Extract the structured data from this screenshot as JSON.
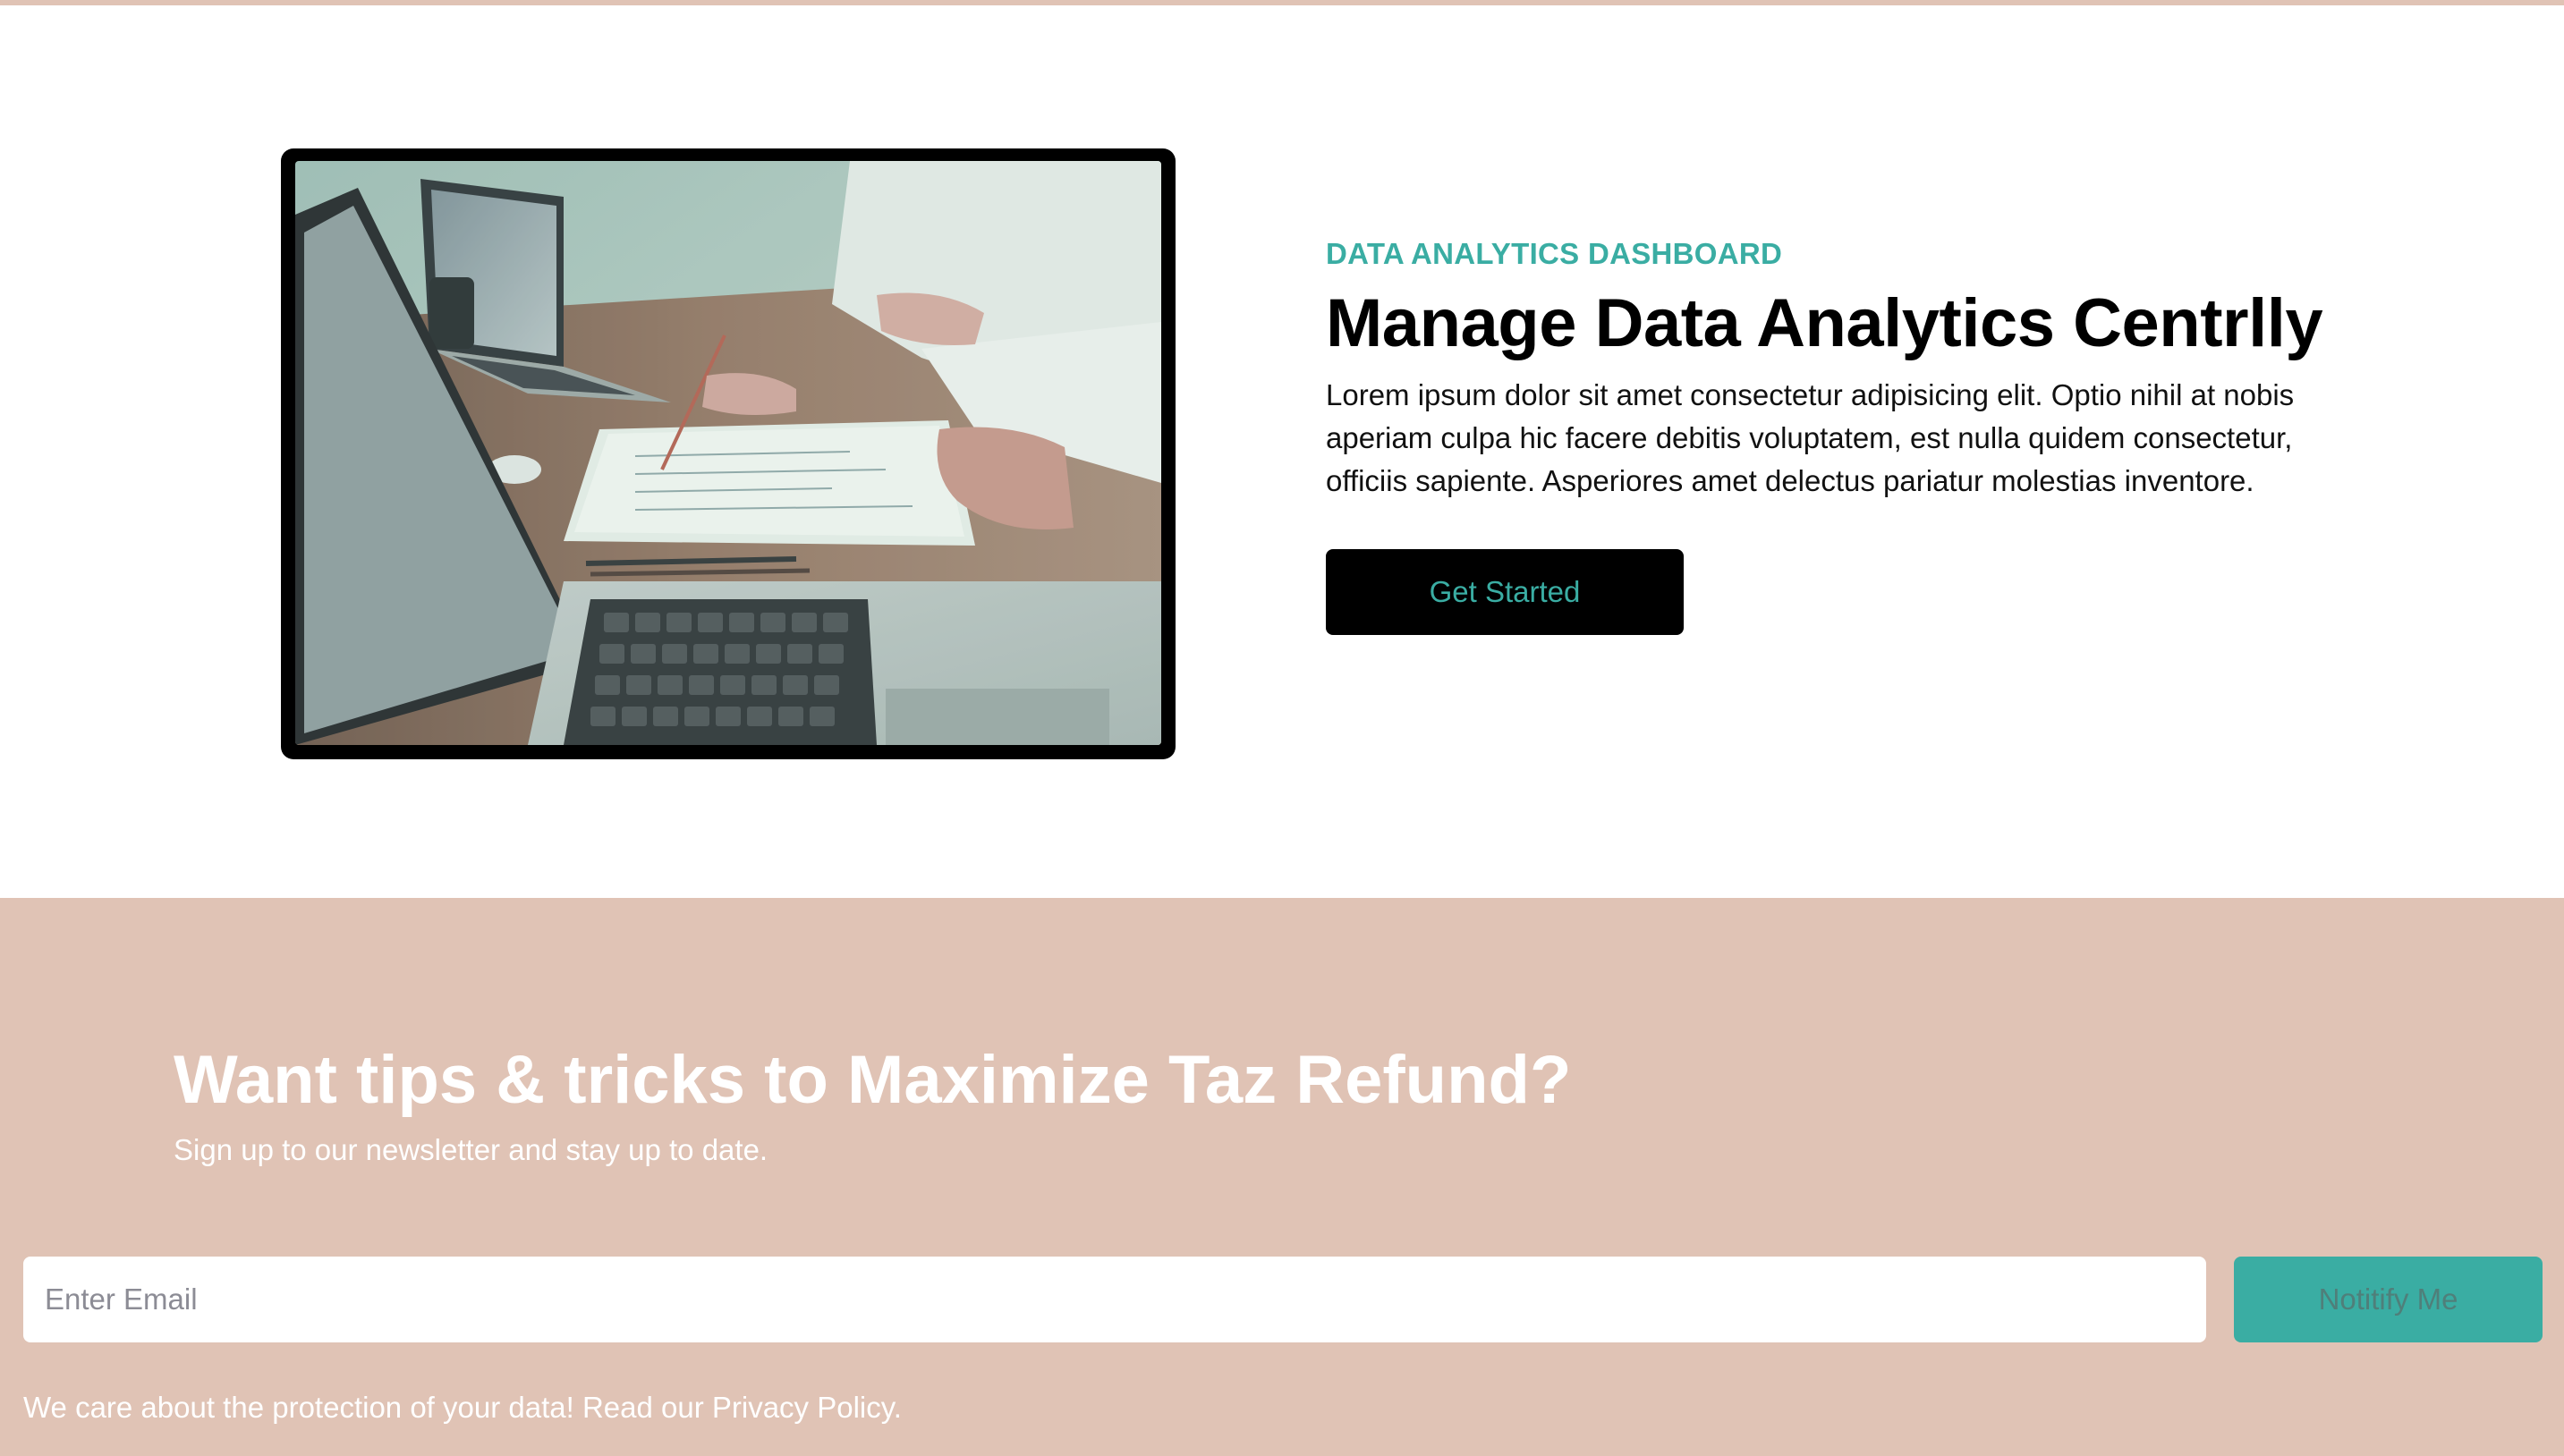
{
  "hero": {
    "eyebrow": "DATA ANALYTICS DASHBOARD",
    "headline": "Manage Data Analytics Centrlly",
    "body": "Lorem ipsum dolor sit amet consectetur adipisicing elit. Optio nihil at nobis aperiam culpa hic facere debitis voluptatem, est nulla quidem consectetur, officiis sapiente. Asperiores amet delectus pariatur molestias inventore.",
    "cta_label": "Get Started",
    "image_subject": "laptops-and-papers-photo"
  },
  "newsletter": {
    "title": "Want tips & tricks to Maximize Taz Refund?",
    "subtitle": "Sign up to our newsletter and stay up to date.",
    "email_placeholder": "Enter Email",
    "email_value": "",
    "submit_label": "Notitify Me",
    "privacy_note": "We care about the protection of your data! Read our Privacy Policy."
  },
  "colors": {
    "accent": "#3aada3",
    "banner_background": "#e0c3b5",
    "frame": "#000000"
  }
}
